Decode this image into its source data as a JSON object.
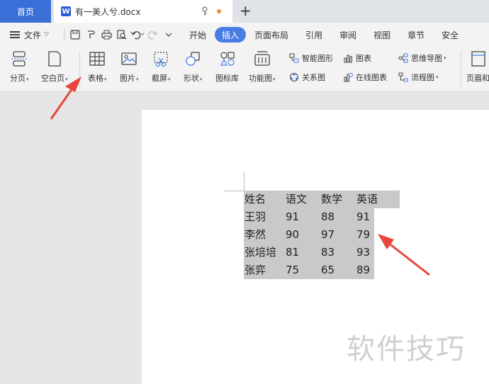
{
  "titlebar": {
    "home_tab": "首页",
    "doc_icon": "W",
    "doc_name": "有一美人兮.docx"
  },
  "menubar": {
    "file_label": "文件",
    "tabs": [
      {
        "label": "开始"
      },
      {
        "label": "插入"
      },
      {
        "label": "页面布局"
      },
      {
        "label": "引用"
      },
      {
        "label": "审阅"
      },
      {
        "label": "视图"
      },
      {
        "label": "章节"
      },
      {
        "label": "安全"
      }
    ]
  },
  "ribbon": {
    "buttons": [
      {
        "label": "分页",
        "icon": "page-break-icon"
      },
      {
        "label": "空白页",
        "icon": "blank-page-icon"
      },
      {
        "label": "表格",
        "icon": "table-icon"
      },
      {
        "label": "图片",
        "icon": "picture-icon"
      },
      {
        "label": "截屏",
        "icon": "screenshot-icon"
      },
      {
        "label": "形状",
        "icon": "shape-icon"
      },
      {
        "label": "图标库",
        "icon": "icon-library-icon"
      },
      {
        "label": "功能图",
        "icon": "function-chart-icon"
      }
    ],
    "small": [
      {
        "label": "智能图形",
        "icon": "smart-graphic-icon"
      },
      {
        "label": "关系图",
        "icon": "relation-chart-icon"
      },
      {
        "label": "图表",
        "icon": "chart-icon"
      },
      {
        "label": "在线图表",
        "icon": "online-chart-icon"
      },
      {
        "label": "思维导图",
        "icon": "mind-map-icon"
      },
      {
        "label": "流程图",
        "icon": "flowchart-icon"
      }
    ],
    "header_footer_partial": "页眉和"
  },
  "table": {
    "header": [
      "姓名",
      "语文",
      "数学",
      "英语"
    ],
    "rows": [
      [
        "王羽",
        "91",
        "88",
        "91"
      ],
      [
        "李然",
        "90",
        "97",
        "79"
      ],
      [
        "张培培",
        "81",
        "83",
        "93"
      ],
      [
        "张弈",
        "75",
        "65",
        "89"
      ]
    ]
  },
  "watermark": "软件技巧",
  "colors": {
    "accent": "#3a6fd8",
    "active_tab": "#4a7de3",
    "selection": "#c9c9c9",
    "arrow": "#e8453c"
  }
}
